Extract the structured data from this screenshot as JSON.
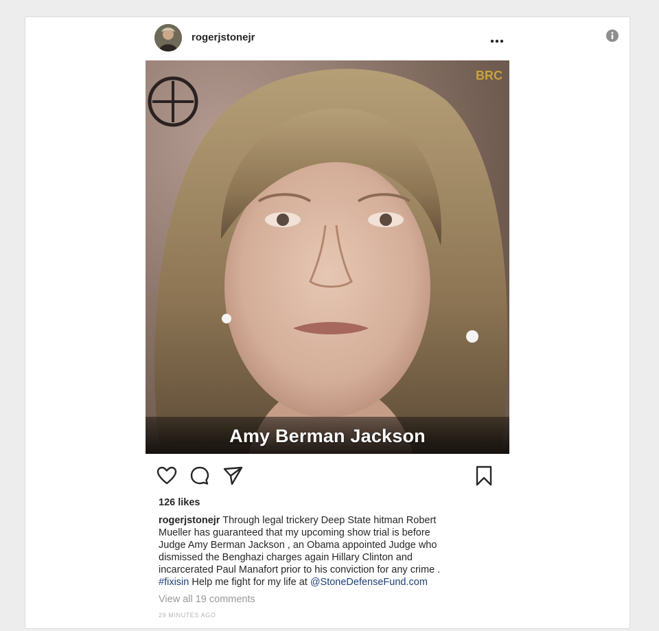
{
  "post": {
    "username": "rogerjstonejr",
    "image_caption": "Amy Berman Jackson",
    "watermark": "BRC",
    "likes": "126 likes",
    "caption": {
      "user": "rogerjstonejr",
      "line1": "Through legal trickery Deep State hitman Robert",
      "line2": "Mueller has guaranteed that my upcoming show trial is before",
      "line3": "Judge Amy Berman Jackson , an Obama appointed Judge who",
      "line4": "dismissed the Benghazi charges again Hillary Clinton and",
      "line5": "incarcerated Paul Manafort prior to his conviction for any crime .",
      "hashtag": "#fixisin",
      "line6_mid": "Help me fight for my life at",
      "mention": "@StoneDefenseFund.com"
    },
    "comments_link": "View all 19 comments",
    "time": "29 MINUTES AGO"
  },
  "icons": {
    "info": "info-icon",
    "more": "more-options-icon",
    "like": "heart-icon",
    "comment": "comment-bubble-icon",
    "share": "paper-plane-icon",
    "save": "bookmark-icon"
  },
  "colors": {
    "link": "#1d3f74",
    "muted": "#999999",
    "text": "#262626"
  }
}
